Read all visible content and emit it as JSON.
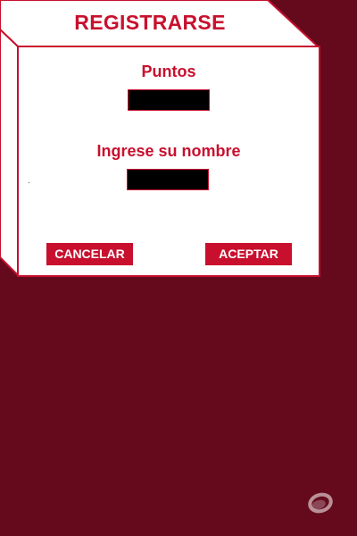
{
  "dialog": {
    "title": "REGISTRARSE",
    "points_label": "Puntos",
    "points_value": "",
    "name_label": "Ingrese su nombre",
    "name_value": "",
    "cancel_label": "CANCELAR",
    "accept_label": "ACEPTAR"
  },
  "icons": {
    "corner": "logo-mark"
  },
  "colors": {
    "background": "#650a1c",
    "panel": "#ffffff",
    "accent": "#c8102e",
    "field_fill": "#000000"
  }
}
